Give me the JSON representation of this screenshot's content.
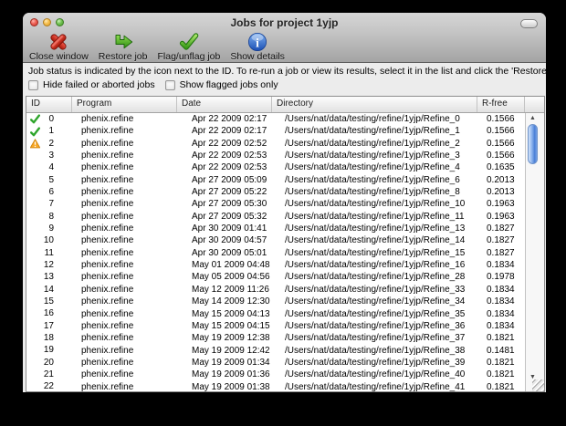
{
  "window": {
    "title": "Jobs for project 1yjp"
  },
  "toolbar": {
    "items": [
      {
        "label": "Close window",
        "icon": "close-x-icon"
      },
      {
        "label": "Restore job",
        "icon": "restore-arrow-icon"
      },
      {
        "label": "Flag/unflag job",
        "icon": "flag-check-icon"
      },
      {
        "label": "Show details",
        "icon": "info-icon"
      }
    ]
  },
  "info_text": "Job status is indicated by the icon next to the ID. To re-run a job or view its results, select it in the list and click the 'Restore' button.",
  "filters": [
    {
      "label": "Hide failed or aborted jobs",
      "checked": false
    },
    {
      "label": "Show flagged jobs only",
      "checked": false
    }
  ],
  "table": {
    "columns": [
      "ID",
      "Program",
      "Date",
      "Directory",
      "R-free"
    ],
    "rows": [
      {
        "id": "0",
        "status": "success",
        "program": "phenix.refine",
        "date": "Apr 22 2009 02:17",
        "directory": "/Users/nat/data/testing/refine/1yjp/Refine_0",
        "rfree": "0.1566"
      },
      {
        "id": "1",
        "status": "success",
        "program": "phenix.refine",
        "date": "Apr 22 2009 02:17",
        "directory": "/Users/nat/data/testing/refine/1yjp/Refine_1",
        "rfree": "0.1566"
      },
      {
        "id": "2",
        "status": "warning",
        "program": "phenix.refine",
        "date": "Apr 22 2009 02:52",
        "directory": "/Users/nat/data/testing/refine/1yjp/Refine_2",
        "rfree": "0.1566"
      },
      {
        "id": "3",
        "status": "",
        "program": "phenix.refine",
        "date": "Apr 22 2009 02:53",
        "directory": "/Users/nat/data/testing/refine/1yjp/Refine_3",
        "rfree": "0.1566"
      },
      {
        "id": "4",
        "status": "",
        "program": "phenix.refine",
        "date": "Apr 22 2009 02:53",
        "directory": "/Users/nat/data/testing/refine/1yjp/Refine_4",
        "rfree": "0.1635"
      },
      {
        "id": "5",
        "status": "",
        "program": "phenix.refine",
        "date": "Apr 27 2009 05:09",
        "directory": "/Users/nat/data/testing/refine/1yjp/Refine_6",
        "rfree": "0.2013"
      },
      {
        "id": "6",
        "status": "",
        "program": "phenix.refine",
        "date": "Apr 27 2009 05:22",
        "directory": "/Users/nat/data/testing/refine/1yjp/Refine_8",
        "rfree": "0.2013"
      },
      {
        "id": "7",
        "status": "",
        "program": "phenix.refine",
        "date": "Apr 27 2009 05:30",
        "directory": "/Users/nat/data/testing/refine/1yjp/Refine_10",
        "rfree": "0.1963"
      },
      {
        "id": "8",
        "status": "",
        "program": "phenix.refine",
        "date": "Apr 27 2009 05:32",
        "directory": "/Users/nat/data/testing/refine/1yjp/Refine_11",
        "rfree": "0.1963"
      },
      {
        "id": "9",
        "status": "",
        "program": "phenix.refine",
        "date": "Apr 30 2009 01:41",
        "directory": "/Users/nat/data/testing/refine/1yjp/Refine_13",
        "rfree": "0.1827"
      },
      {
        "id": "10",
        "status": "",
        "program": "phenix.refine",
        "date": "Apr 30 2009 04:57",
        "directory": "/Users/nat/data/testing/refine/1yjp/Refine_14",
        "rfree": "0.1827"
      },
      {
        "id": "11",
        "status": "",
        "program": "phenix.refine",
        "date": "Apr 30 2009 05:01",
        "directory": "/Users/nat/data/testing/refine/1yjp/Refine_15",
        "rfree": "0.1827"
      },
      {
        "id": "12",
        "status": "",
        "program": "phenix.refine",
        "date": "May 01 2009 04:48",
        "directory": "/Users/nat/data/testing/refine/1yjp/Refine_16",
        "rfree": "0.1834"
      },
      {
        "id": "13",
        "status": "",
        "program": "phenix.refine",
        "date": "May 05 2009 04:56",
        "directory": "/Users/nat/data/testing/refine/1yjp/Refine_28",
        "rfree": "0.1978"
      },
      {
        "id": "14",
        "status": "",
        "program": "phenix.refine",
        "date": "May 12 2009 11:26",
        "directory": "/Users/nat/data/testing/refine/1yjp/Refine_33",
        "rfree": "0.1834"
      },
      {
        "id": "15",
        "status": "",
        "program": "phenix.refine",
        "date": "May 14 2009 12:30",
        "directory": "/Users/nat/data/testing/refine/1yjp/Refine_34",
        "rfree": "0.1834"
      },
      {
        "id": "16",
        "status": "",
        "program": "phenix.refine",
        "date": "May 15 2009 04:13",
        "directory": "/Users/nat/data/testing/refine/1yjp/Refine_35",
        "rfree": "0.1834"
      },
      {
        "id": "17",
        "status": "",
        "program": "phenix.refine",
        "date": "May 15 2009 04:15",
        "directory": "/Users/nat/data/testing/refine/1yjp/Refine_36",
        "rfree": "0.1834"
      },
      {
        "id": "18",
        "status": "",
        "program": "phenix.refine",
        "date": "May 19 2009 12:38",
        "directory": "/Users/nat/data/testing/refine/1yjp/Refine_37",
        "rfree": "0.1821"
      },
      {
        "id": "19",
        "status": "",
        "program": "phenix.refine",
        "date": "May 19 2009 12:42",
        "directory": "/Users/nat/data/testing/refine/1yjp/Refine_38",
        "rfree": "0.1481"
      },
      {
        "id": "20",
        "status": "",
        "program": "phenix.refine",
        "date": "May 19 2009 01:34",
        "directory": "/Users/nat/data/testing/refine/1yjp/Refine_39",
        "rfree": "0.1821"
      },
      {
        "id": "21",
        "status": "",
        "program": "phenix.refine",
        "date": "May 19 2009 01:36",
        "directory": "/Users/nat/data/testing/refine/1yjp/Refine_40",
        "rfree": "0.1821"
      },
      {
        "id": "22",
        "status": "",
        "program": "phenix.refine",
        "date": "May 19 2009 01:38",
        "directory": "/Users/nat/data/testing/refine/1yjp/Refine_41",
        "rfree": "0.1821"
      }
    ]
  },
  "colors": {
    "status_success": "#2fa52c",
    "status_warning": "#f9a825",
    "scrollbar_thumb": "#4a7fd6",
    "titlebar_top": "#d6d6d6",
    "titlebar_bottom": "#a4a4a4"
  }
}
